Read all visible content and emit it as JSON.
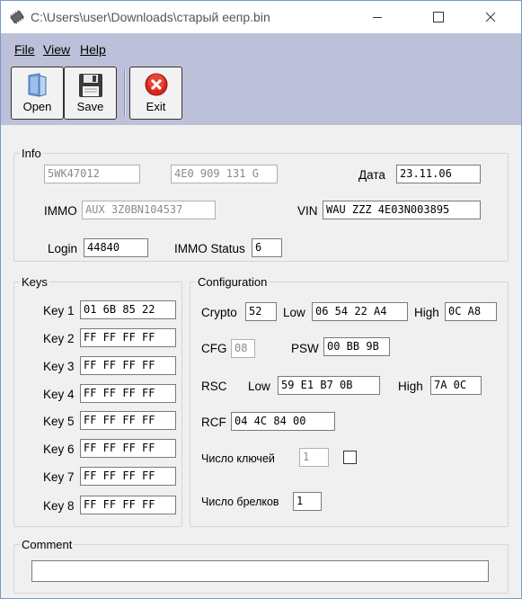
{
  "window": {
    "title": "C:\\Users\\user\\Downloads\\старый еепр.bin",
    "icons": {
      "app": "eeprom-chip-icon",
      "minimize": "minimize-icon",
      "maximize": "maximize-icon",
      "close": "close-icon"
    }
  },
  "menu": {
    "file": "File",
    "view": "View",
    "help": "Help"
  },
  "toolbar": {
    "open": {
      "label": "Open",
      "icon": "open-folder-icon"
    },
    "save": {
      "label": "Save",
      "icon": "floppy-disk-icon"
    },
    "exit": {
      "label": "Exit",
      "icon": "exit-x-icon"
    }
  },
  "info": {
    "title": "Info",
    "field1": "5WK47012",
    "field2": "4E0 909 131 G",
    "date_label": "Дата",
    "date": "23.11.06",
    "immo_label": "IMMO",
    "immo": "AUX 3Z0BN104537",
    "vin_label": "VIN",
    "vin": "WAU ZZZ 4E03N003895",
    "login_label": "Login",
    "login": "44840",
    "immo_status_label": "IMMO Status",
    "immo_status": "6"
  },
  "keys": {
    "title": "Keys",
    "items": [
      {
        "label": "Key 1",
        "value": "01 6B 85 22"
      },
      {
        "label": "Key 2",
        "value": "FF FF FF FF"
      },
      {
        "label": "Key 3",
        "value": "FF FF FF FF"
      },
      {
        "label": "Key 4",
        "value": "FF FF FF FF"
      },
      {
        "label": "Key 5",
        "value": "FF FF FF FF"
      },
      {
        "label": "Key 6",
        "value": "FF FF FF FF"
      },
      {
        "label": "Key 7",
        "value": "FF FF FF FF"
      },
      {
        "label": "Key 8",
        "value": "FF FF FF FF"
      }
    ]
  },
  "config": {
    "title": "Configuration",
    "crypto_label": "Crypto",
    "crypto": "52",
    "low_label": "Low",
    "crypto_low": "06 54 22 A4",
    "high_label": "High",
    "crypto_high": "0C A8",
    "cfg_label": "CFG",
    "cfg": "08",
    "psw_label": "PSW",
    "psw": "00 BB 9B",
    "rsc_label": "RSC",
    "rsc_low": "59 E1 B7 0B",
    "rsc_high": "7A 0C",
    "rcf_label": "RCF",
    "rcf": "04 4C 84 00",
    "num_keys_label": "Число ключей",
    "num_keys": "1",
    "num_fobs_label": "Число брелков",
    "num_fobs": "1"
  },
  "comment": {
    "title": "Comment",
    "value": ""
  }
}
